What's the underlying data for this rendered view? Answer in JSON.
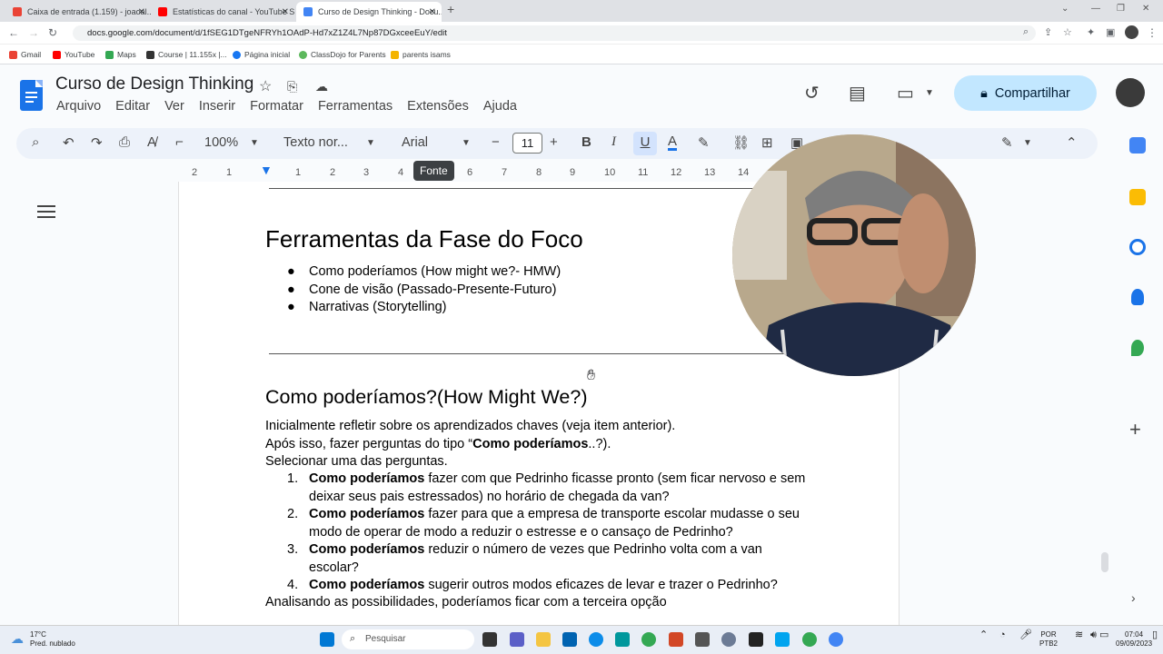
{
  "browser": {
    "tabs": [
      {
        "label": "Caixa de entrada (1.159) - joaoal...",
        "color": "#ea4335"
      },
      {
        "label": "Estatísticas do canal - YouTube S...",
        "color": "#ff0000"
      },
      {
        "label": "Curso de Design Thinking - Docu...",
        "color": "#4285f4"
      }
    ],
    "url": "docs.google.com/document/d/1fSEG1DTgeNFRYh1OAdP-Hd7xZ1Z4L7Np87DGxceeEuY/edit",
    "bookmarks": [
      {
        "label": "Gmail",
        "color": "#ea4335"
      },
      {
        "label": "YouTube",
        "color": "#ff0000"
      },
      {
        "label": "Maps",
        "color": "#34a853"
      },
      {
        "label": "Course | 11.155x |...",
        "color": "#333333"
      },
      {
        "label": "Página inicial",
        "color": "#1877f2"
      },
      {
        "label": "ClassDojo for Parents",
        "color": "#5cb85c"
      },
      {
        "label": "parents isams",
        "color": "#f4b400"
      }
    ]
  },
  "doc": {
    "title": "Curso de Design Thinking",
    "menu": [
      "Arquivo",
      "Editar",
      "Ver",
      "Inserir",
      "Formatar",
      "Ferramentas",
      "Extensões",
      "Ajuda"
    ],
    "share_label": "Compartilhar"
  },
  "toolbar": {
    "zoom": "100%",
    "style": "Texto nor...",
    "font": "Arial",
    "font_size": "11",
    "tooltip": "Fonte"
  },
  "ruler": [
    "2",
    "1",
    "1",
    "2",
    "3",
    "4",
    "5",
    "6",
    "7",
    "8",
    "9",
    "10",
    "11",
    "12",
    "13",
    "14"
  ],
  "content": {
    "heading1": "Ferramentas da Fase do Foco",
    "bullets": [
      "Como poderíamos (How might we?- HMW)",
      "Cone de visão (Passado-Presente-Futuro)",
      "Narrativas (Storytelling)"
    ],
    "heading2": "Como poderíamos?(How Might We?)",
    "p1": "Inicialmente refletir sobre os aprendizados chaves (veja item anterior).",
    "p2_pre": "Após isso, fazer perguntas do tipo “",
    "p2_bold": "Como poderíamos",
    "p2_post": "..?).",
    "p3": "Selecionar uma das perguntas.",
    "numbered": [
      {
        "n": "1.",
        "bold": "Como poderíamos",
        "line1": " fazer com que Pedrinho ficasse pronto (sem ficar nervoso e sem",
        "line2": "deixar seus pais estressados) no horário de chegada da van?"
      },
      {
        "n": "2.",
        "bold": "Como poderíamos",
        "line1": " fazer para que a empresa de transporte escolar mudasse o seu",
        "line2": "modo de operar de modo a reduzir o estresse e o cansaço de Pedrinho?"
      },
      {
        "n": "3.",
        "bold": "Como poderíamos",
        "line1": " reduzir o número de vezes que Pedrinho volta com a van",
        "line2": "escolar?"
      },
      {
        "n": "4.",
        "bold": "Como poderíamos",
        "line1": " sugerir outros modos eficazes de levar e trazer o Pedrinho?",
        "line2": ""
      }
    ],
    "p4": "Analisando as possibilidades, poderíamos ficar com a terceira opção"
  },
  "taskbar": {
    "weather_temp": "17°C",
    "weather_desc": "Pred. nublado",
    "search_placeholder": "Pesquisar",
    "lang": "POR",
    "lang2": "PTB2",
    "time": "07:04",
    "date": "09/09/2023"
  }
}
